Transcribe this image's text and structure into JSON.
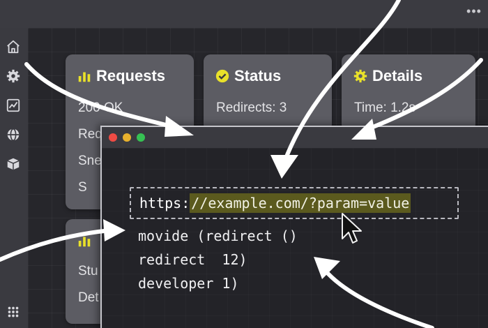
{
  "topbar": {
    "more_icon": "ellipsis-icon",
    "more_label": "•••"
  },
  "sidebar": {
    "items": [
      {
        "icon": "home-icon"
      },
      {
        "icon": "gear-icon"
      },
      {
        "icon": "chart-line-icon"
      },
      {
        "icon": "globe-icon"
      },
      {
        "icon": "box-icon"
      },
      {
        "icon": "apps-grid-icon"
      }
    ]
  },
  "cards": {
    "requests": {
      "title": "Requests",
      "icon": "bar-chart-icon",
      "lines": [
        "200 OK",
        "Req",
        "Sne",
        "S"
      ]
    },
    "status": {
      "title": "Status",
      "icon": "check-circle-icon",
      "lines": [
        "Redirects: 3"
      ]
    },
    "details": {
      "title": "Details",
      "icon": "gear-icon",
      "lines": [
        "Time: 1.2s"
      ]
    },
    "lower": {
      "title": "",
      "icon": "bar-chart-icon",
      "lines": [
        "Stu",
        "Det"
      ]
    }
  },
  "terminal": {
    "window_dots": [
      "close",
      "minimize",
      "maximize"
    ],
    "url_prefix": "https:",
    "url_highlight": "//example.com/?param=value",
    "lines": [
      "movide (redirect ()",
      "redirect  12)",
      "developer 1)"
    ]
  },
  "colors": {
    "accent_yellow": "#e9e12a",
    "highlight": "#5b5a1e",
    "card": "#5c5c63",
    "background": "#26262b"
  }
}
